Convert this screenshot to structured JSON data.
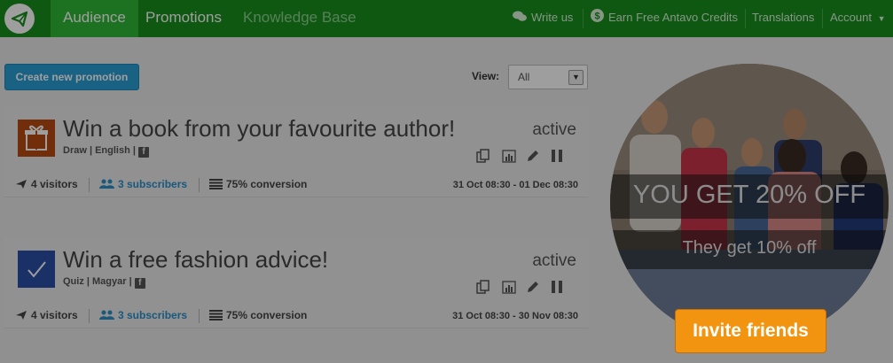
{
  "nav": {
    "tabs": [
      {
        "label": "Audience",
        "active": true
      },
      {
        "label": "Promotions",
        "active": false
      },
      {
        "label": "Knowledge Base",
        "active": false
      }
    ],
    "right": [
      {
        "label": "Write us",
        "icon": "chat-bubbles-icon"
      },
      {
        "label": "Earn Free Antavo Credits",
        "icon": "dollar-circle-icon"
      },
      {
        "label": "Translations"
      },
      {
        "label": "Account",
        "icon": "caret-down-icon"
      }
    ],
    "logo_icon": "paper-plane-icon"
  },
  "toolbar": {
    "create_label": "Create new promotion",
    "view_label": "View:",
    "view_value": "All"
  },
  "promotions": [
    {
      "title": "Win a book from your favourite author!",
      "meta": "Draw | English |",
      "status": "active",
      "icon": "gift-icon",
      "icon_color": "#b84a12",
      "visitors": "4 visitors",
      "subscribers": "3 subscribers",
      "conversion": "75% conversion",
      "dates": "31 Oct 08:30 - 01 Dec 08:30"
    },
    {
      "title": "Win a free fashion advice!",
      "meta": "Quiz | Magyar |",
      "status": "active",
      "icon": "checkmark-icon",
      "icon_color": "#2b4fa8",
      "visitors": "4 visitors",
      "subscribers": "3 subscribers",
      "conversion": "75% conversion",
      "dates": "31 Oct 08:30 - 30 Nov 08:30"
    }
  ],
  "promo": {
    "headline": "YOU GET 20% OFF",
    "subline": "They get 10% off",
    "cta": "Invite friends"
  },
  "colors": {
    "nav_bg": "#178f1d",
    "nav_active": "#2fb838",
    "link": "#2a8ec8",
    "cta": "#f39411"
  }
}
